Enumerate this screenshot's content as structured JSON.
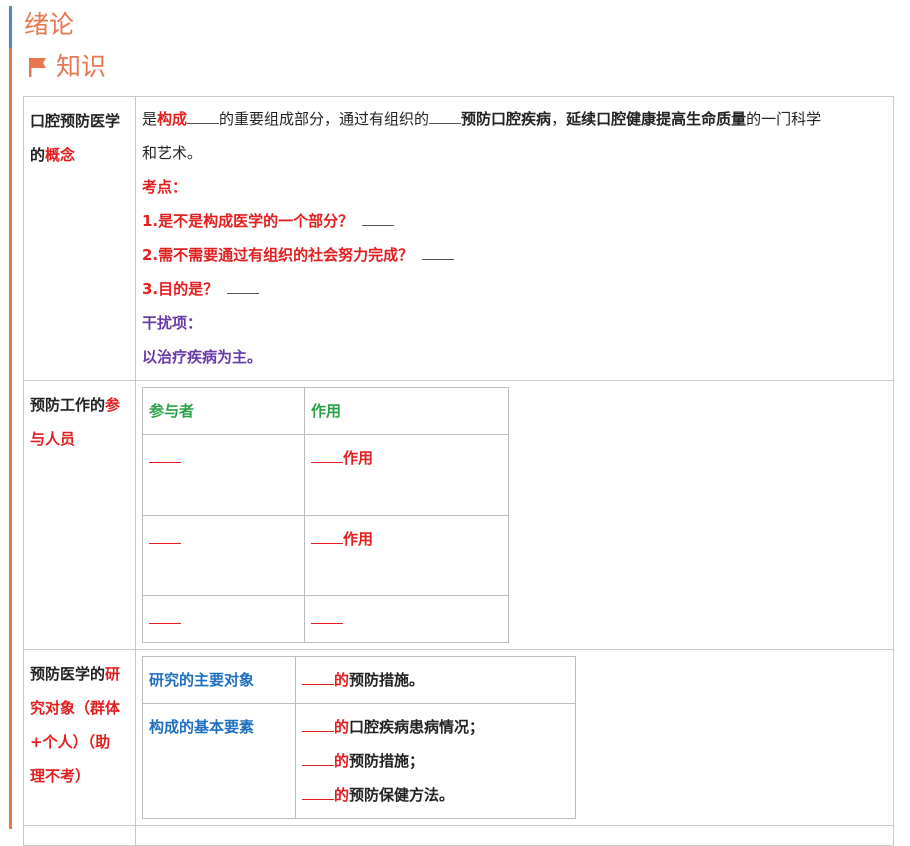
{
  "heading": {
    "title": "绪论",
    "subtitle": "知识",
    "flag_icon": "flag-icon"
  },
  "colors": {
    "accent_orange": "#e8774f",
    "accent_blue": "#4f86c6",
    "keyword_red": "#e41e1e",
    "distractor_purple": "#6a3aa8",
    "header_green": "#2aa148",
    "header_blue": "#1f6fbe"
  },
  "row1": {
    "label_a": "口腔预防医学",
    "label_b": "的",
    "label_c": "概念",
    "def_1": "是",
    "def_2": "构成",
    "def_3": "的重要组成部分，通过有组织的",
    "def_4": "预防口腔疾病",
    "def_5": "，",
    "def_6": "延续口腔健康提高生命质量",
    "def_7": "的一门科学",
    "def_8": "和艺术。",
    "kaodian": "考点：",
    "q1": "1.是不是构成医学的一个部分？",
    "q2": "2.需不需要通过有组织的社会努力完成？",
    "q3": "3.目的是？",
    "distractor_title": "干扰项：",
    "distractor": "以治疗疾病为主。"
  },
  "row2": {
    "label_a": "预防工作的",
    "label_b": "参",
    "label_c": "与人员",
    "headers": [
      "参与者",
      "作用"
    ],
    "role_suffix": "作用"
  },
  "row3": {
    "label_a": "预防医学的",
    "label_b": "研",
    "label_c": "究对象（群体",
    "label_d": "+个人）（助",
    "label_e": "理不考）",
    "r1_head": "研究的主要对象",
    "r1_red": "的",
    "r1_text": "预防措施。",
    "r2_head": "构成的基本要素",
    "r2_red": "的",
    "r2_l1": "口腔疾病患病情况；",
    "r2_l2": "预防措施；",
    "r2_l3": "预防保健方法。"
  }
}
